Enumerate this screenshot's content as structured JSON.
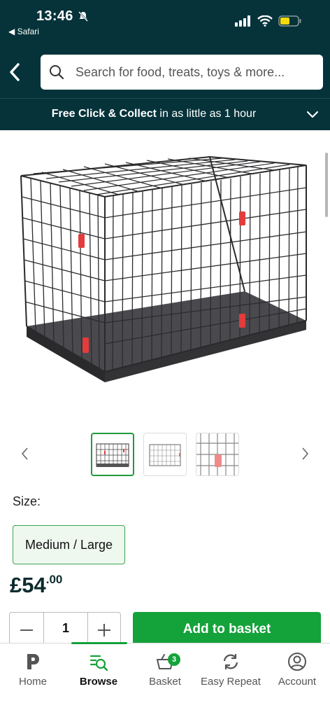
{
  "status_bar": {
    "time": "13:46",
    "back_app": "◀ Safari"
  },
  "header": {
    "search_placeholder": "Search for food, treats, toys & more..."
  },
  "promo": {
    "bold_text": "Free Click & Collect",
    "text": " in as little as 1 hour"
  },
  "product": {
    "size_label": "Size:",
    "size_option": "Medium / Large",
    "price_main": "£54",
    "price_cents": ".00",
    "quantity": "1",
    "add_button": "Add to basket"
  },
  "gallery": {
    "thumbnail_count": 3,
    "active_index": 0
  },
  "tabs": [
    {
      "label": "Home",
      "icon": "pets-logo-icon"
    },
    {
      "label": "Browse",
      "icon": "browse-search-icon"
    },
    {
      "label": "Basket",
      "icon": "basket-icon",
      "badge": "3"
    },
    {
      "label": "Easy Repeat",
      "icon": "repeat-icon"
    },
    {
      "label": "Account",
      "icon": "account-icon"
    }
  ],
  "colors": {
    "header_bg": "#06333a",
    "accent_green": "#14a23a",
    "selected_size_bg": "#eef8ef"
  }
}
